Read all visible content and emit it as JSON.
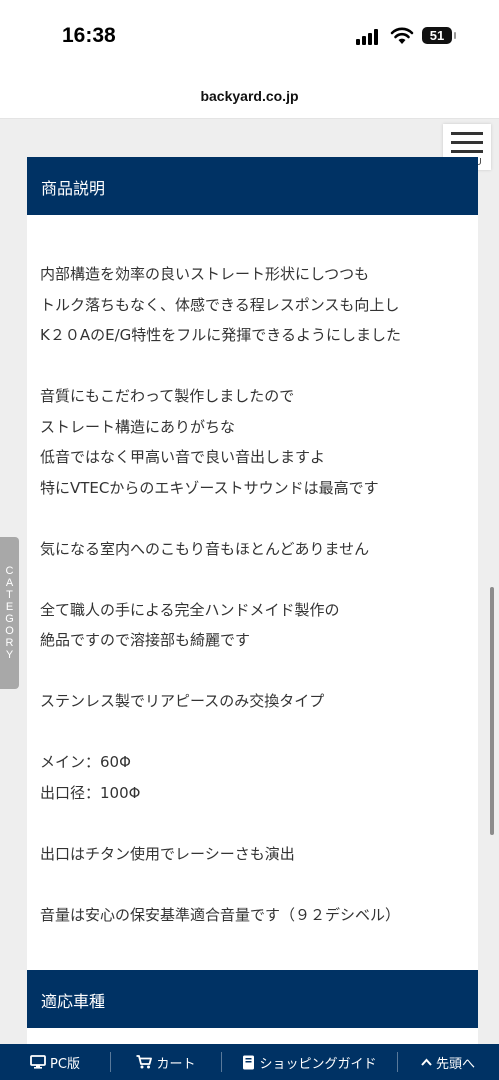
{
  "status_bar": {
    "time": "16:38",
    "battery": "51"
  },
  "browser": {
    "url": "backyard.co.jp"
  },
  "menu": {
    "label": "MENU"
  },
  "category_tab": {
    "label": "CATEGORY"
  },
  "sections": {
    "description_title": "商品説明",
    "vehicles_title": "適応車種"
  },
  "description": {
    "paragraphs": [
      [
        "内部構造を効率の良いストレート形状にしつつも",
        "トルク落ちもなく、体感できる程レスポンスも向上し",
        "K２０AのE/G特性をフルに発揮できるようにしました"
      ],
      [
        "音質にもこだわって製作しましたので",
        "ストレート構造にありがちな",
        "低音ではなく甲高い音で良い音出しますよ",
        "特にVTECからのエキゾーストサウンドは最高です"
      ],
      [
        "気になる室内へのこもり音もほとんどありません"
      ],
      [
        "全て職人の手による完全ハンドメイド製作の",
        "絶品ですので溶接部も綺麗です"
      ],
      [
        "ステンレス製でリアピースのみ交換タイプ"
      ],
      [
        "メイン：60Φ",
        "出口径：100Φ"
      ],
      [
        "出口はチタン使用でレーシーさも演出"
      ],
      [
        "音量は安心の保安基準適合音量です（９２デシベル）"
      ]
    ]
  },
  "bottom_nav": {
    "pc": "PC版",
    "cart": "カート",
    "guide": "ショッピングガイド",
    "top": "先頭へ"
  },
  "colors": {
    "navy": "#003264",
    "background": "#eeeeee",
    "card": "#ffffff"
  }
}
